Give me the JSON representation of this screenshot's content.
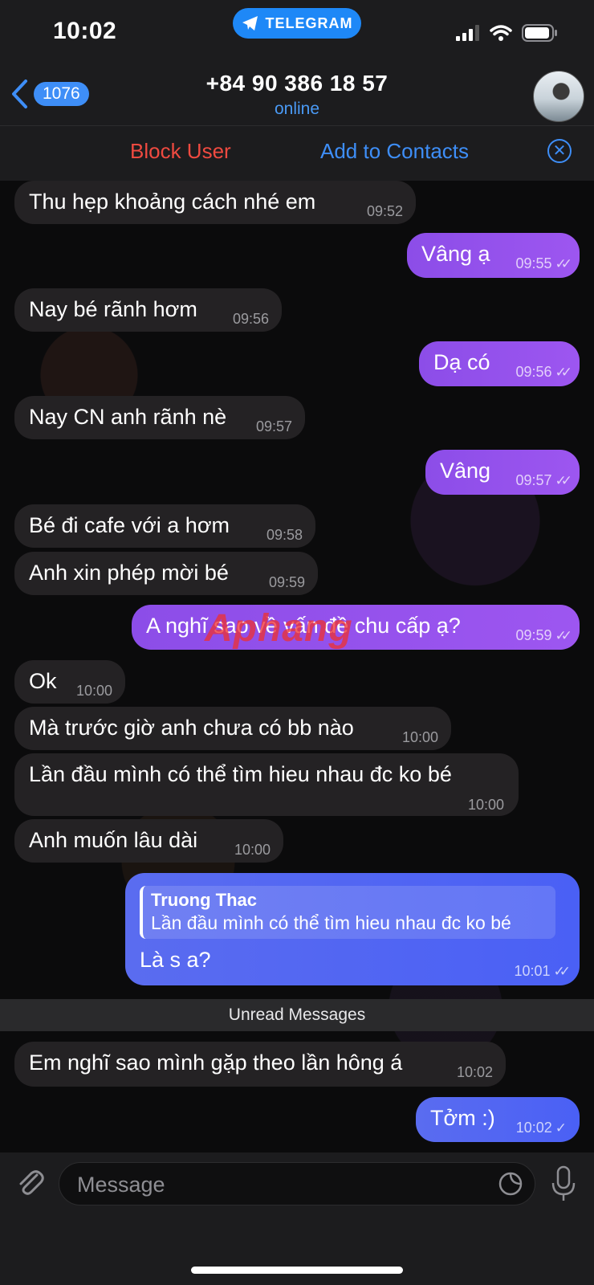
{
  "status_bar": {
    "time": "10:02",
    "app_pill": "TELEGRAM"
  },
  "header": {
    "back_badge": "1076",
    "title": "+84 90 386 18 57",
    "subtitle": "online",
    "block_label": "Block User",
    "add_contact_label": "Add to Contacts"
  },
  "messages": [
    {
      "dir": "in",
      "text": "Thu hẹp khoảng cách nhé em",
      "time": "09:52"
    },
    {
      "dir": "out",
      "text": "Vâng ạ",
      "time": "09:55",
      "status": "read"
    },
    {
      "dir": "in",
      "text": "Nay bé rãnh hơm",
      "time": "09:56"
    },
    {
      "dir": "out",
      "text": "Dạ có",
      "time": "09:56",
      "status": "read"
    },
    {
      "dir": "in",
      "text": "Nay CN anh rãnh nè",
      "time": "09:57"
    },
    {
      "dir": "out",
      "text": "Vâng",
      "time": "09:57",
      "status": "read"
    },
    {
      "dir": "in",
      "text": "Bé đi cafe với a hơm",
      "time": "09:58"
    },
    {
      "dir": "in",
      "text": "Anh xin phép mời bé",
      "time": "09:59"
    },
    {
      "dir": "out",
      "text": "A nghĩ sao về vấn đề chu cấp ạ?",
      "time": "09:59",
      "status": "read"
    },
    {
      "dir": "in",
      "text": "Ok",
      "time": "10:00"
    },
    {
      "dir": "in",
      "text": "Mà trước giờ anh chưa có bb nào",
      "time": "10:00"
    },
    {
      "dir": "in",
      "text": "Lần đầu mình có thể tìm hieu nhau đc ko bé",
      "time": "10:00"
    },
    {
      "dir": "in",
      "text": "Anh muốn lâu dài",
      "time": "10:00"
    },
    {
      "dir": "out",
      "text": "Là s a?",
      "time": "10:01",
      "status": "read",
      "reply": {
        "name": "Truong Thac",
        "text": "Lần đầu mình có thể tìm hieu nhau đc ko bé"
      }
    },
    {
      "dir": "in",
      "text": "Em nghĩ sao mình gặp theo lần hông á",
      "time": "10:02"
    },
    {
      "dir": "out",
      "text": "Tởm :)",
      "time": "10:02",
      "status": "sent"
    }
  ],
  "unread_divider": "Unread Messages",
  "watermark": "Aphang",
  "composer": {
    "placeholder": "Message"
  },
  "colors": {
    "accent": "#3e8ef7",
    "danger": "#ef4a40",
    "outgoing_bubble": "#9d56f0"
  }
}
